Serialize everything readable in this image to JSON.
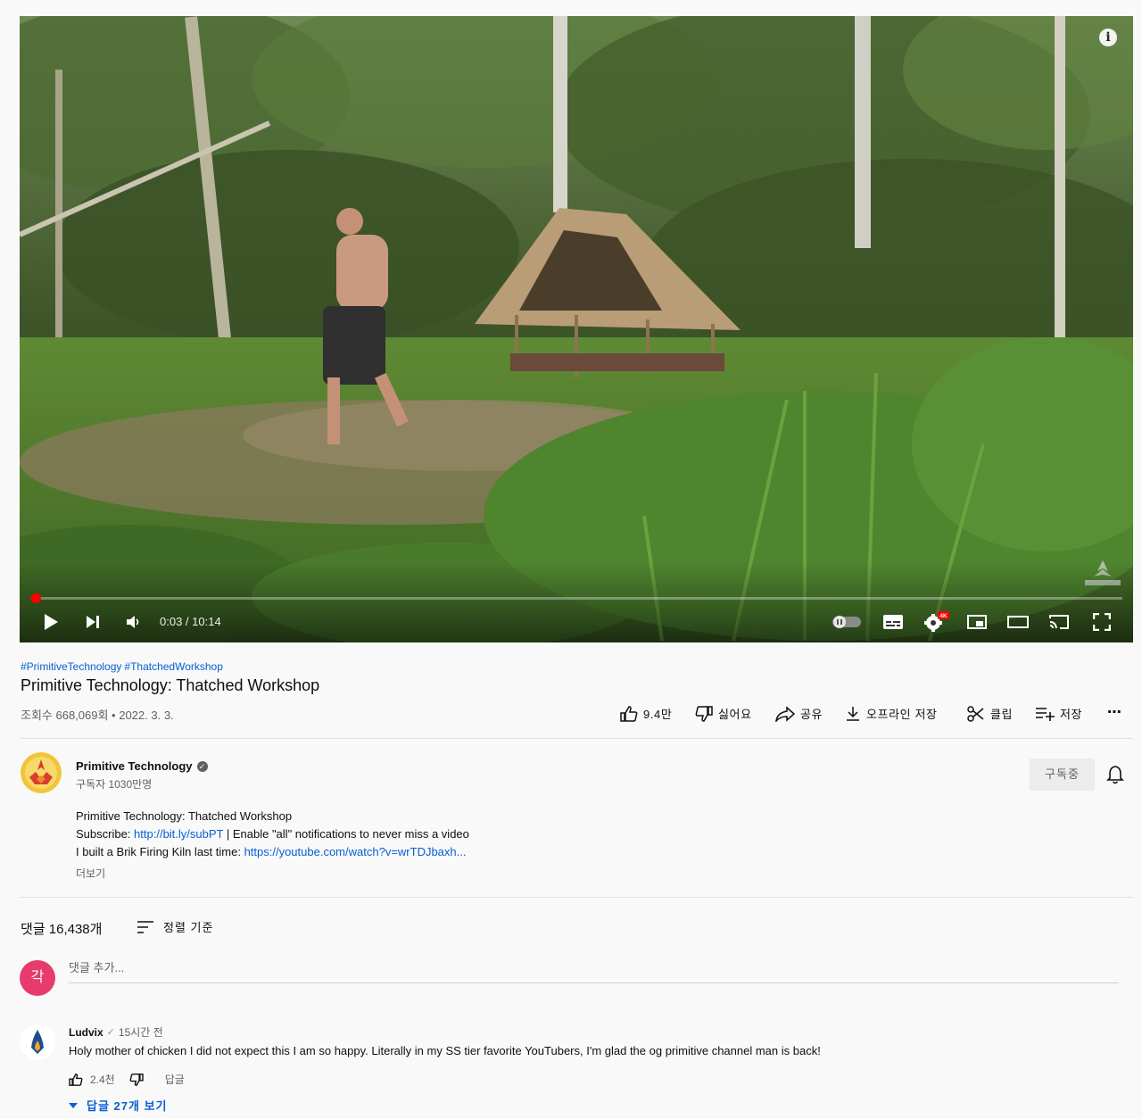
{
  "player": {
    "time_current": "0:03",
    "time_separator": " / ",
    "time_total": "10:14",
    "progress": 0.005,
    "info_icon": "i",
    "watermark_icon": "subscribe-flame-watermark-icon",
    "settings_badge": "4K"
  },
  "video": {
    "hashtags": [
      "#PrimitiveTechnology",
      "#ThatchedWorkshop"
    ],
    "title": "Primitive Technology: Thatched Workshop",
    "meta": "조회수 668,069회 • 2022. 3. 3."
  },
  "actions": {
    "like": "9.4만",
    "dislike": "싫어요",
    "share": "공유",
    "download": "오프라인 저장",
    "clip": "클립",
    "save": "저장",
    "more": "⋯"
  },
  "channel": {
    "name": "Primitive Technology",
    "verified_mark": "✓",
    "subscribers": "구독자 1030만명",
    "subscribe_label": "구독중"
  },
  "description": {
    "line1": "Primitive Technology: Thatched Workshop",
    "line2_prefix": "Subscribe: ",
    "line2_link": "http://bit.ly/subPT",
    "line2_suffix": " | Enable \"all\" notifications to never miss a video",
    "line3_prefix": "I built a Brik Firing Kiln last time: ",
    "line3_link": "https://youtube.com/watch?v=wrTDJbaxh...",
    "more": "더보기"
  },
  "comments": {
    "count": "댓글 16,438개",
    "sort_label": "정렬 기준",
    "my_avatar_letter": "각",
    "add_placeholder": "댓글 추가...",
    "items": [
      {
        "author": "Ludvix",
        "check": "✓",
        "time": "15시간 전",
        "text": "Holy mother of chicken I did not expect this I am so happy. Literally in my SS tier favorite YouTubers, I'm glad the og primitive channel man is back!",
        "likes": "2.4천",
        "reply_label": "답글",
        "replies_label": "답글 27개 보기"
      }
    ]
  },
  "colors": {
    "link": "#065fd4",
    "progress": "#ff0000",
    "my_avatar": "#e63b6c"
  }
}
